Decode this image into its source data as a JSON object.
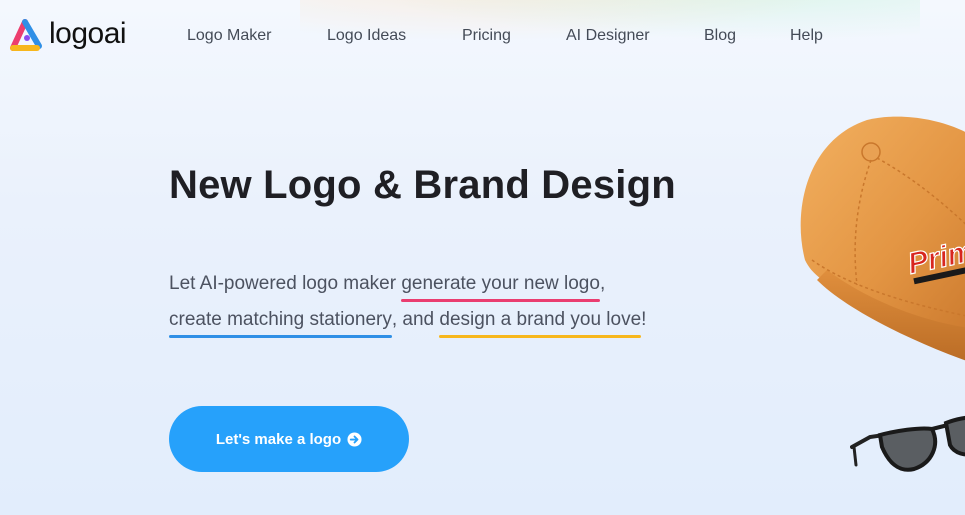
{
  "brand": {
    "name": "logoai"
  },
  "nav": {
    "items": [
      {
        "label": "Logo Maker"
      },
      {
        "label": "Logo Ideas"
      },
      {
        "label": "Pricing"
      },
      {
        "label": "AI Designer"
      },
      {
        "label": "Blog"
      },
      {
        "label": "Help"
      }
    ]
  },
  "hero": {
    "title": "New Logo & Brand Design",
    "subtitle": {
      "part1": "Let AI-powered logo maker ",
      "highlight1": "generate your new logo",
      "part2": ",",
      "highlight2": "create matching stationery",
      "part3": ", and ",
      "highlight3": "design a brand you love",
      "part4": "!"
    },
    "cta_label": "Let's make a logo",
    "cap_print": "Prim"
  },
  "colors": {
    "accent": "#26a1fb",
    "underline_red": "#ea3d70",
    "underline_blue": "#2f8fe6",
    "underline_yellow": "#f7b71d",
    "cap_orange": "#e69a48"
  },
  "icons": {
    "logo_mark": "triangle-logo-icon",
    "cta_icon": "arrow-circle-right-icon"
  }
}
